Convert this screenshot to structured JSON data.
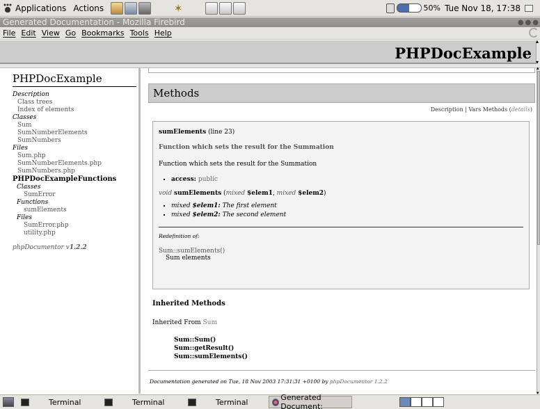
{
  "top_panel": {
    "applications": "Applications",
    "actions": "Actions",
    "battery": "50%",
    "battery_level": 0.5,
    "clock": "Tue Nov 18, 17:38"
  },
  "window": {
    "title": "Generated Documentation - Mozilla Firebird",
    "menus": [
      "File",
      "Edit",
      "View",
      "Go",
      "Bookmarks",
      "Tools",
      "Help"
    ]
  },
  "header": {
    "title": "PHPDocExample"
  },
  "sidebar": {
    "title": "PHPDocExample",
    "description_label": "Description",
    "class_trees": "Class trees",
    "index_of_elements": "Index of elements",
    "classes_label": "Classes",
    "classes": [
      "Sum",
      "SumNumberElements",
      "SumNumbers"
    ],
    "files_label": "Files",
    "files": [
      "Sum.php",
      "SumNumberElements.php",
      "SumNumbers.php"
    ],
    "package": "PHPDocExampleFunctions",
    "pkg_classes_label": "Classes",
    "pkg_classes": [
      "SumError"
    ],
    "functions_label": "Functions",
    "functions": [
      "sumElements"
    ],
    "pkg_files_label": "Files",
    "pkg_files": [
      "SumError.php",
      "utility.php"
    ],
    "version_prefix": "phpDocumentor v",
    "version": "1.2.2"
  },
  "main": {
    "section_title": "Methods",
    "nav": {
      "description": "Description",
      "sep": "|",
      "vars_methods": "Vars Methods",
      "details": "details"
    },
    "method": {
      "name": "sumElements",
      "line": "(line 23)",
      "short_desc": "Function which sets the result for the Summation",
      "long_desc": "Function which sets the result for the Summation",
      "access_tag": "access:",
      "access_value": "public",
      "return_type": "void",
      "proto_name": "sumElements",
      "param1_type": "mixed",
      "param1_name": "$elem1",
      "param2_type": "mixed",
      "param2_name": "$elem2",
      "param1_desc_name": "$elem1:",
      "param1_desc": "The first element",
      "param2_desc_name": "$elem2:",
      "param2_desc": "The second element",
      "redef_label": "Redefinition of:",
      "redef_link": "Sum::sumElements()",
      "redef_desc": "Sum elements"
    },
    "inherited": {
      "heading": "Inherited Methods",
      "from_label": "Inherited From",
      "from_class": "Sum",
      "methods": [
        "Sum::Sum()",
        "Sum::getResult()",
        "Sum::sumElements()"
      ]
    },
    "footer": {
      "text": "Documentation generated on Tue, 18 Nov 2003 17:31:31 +0100 by",
      "tool": "phpDocumentor 1.2.2"
    }
  },
  "taskbar": {
    "tasks": [
      "Terminal",
      "Terminal",
      "Terminal",
      "Generated Document:"
    ]
  }
}
